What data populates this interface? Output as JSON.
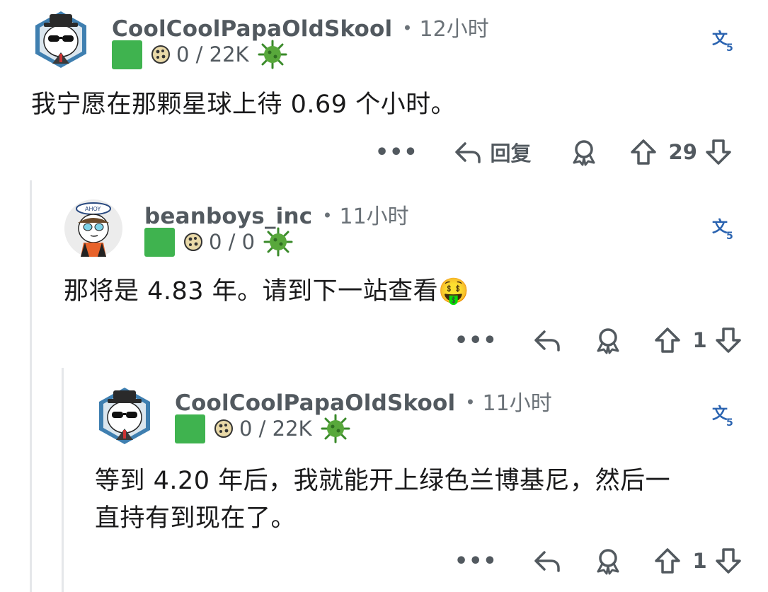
{
  "comments": [
    {
      "username": "CoolCoolPapaOldSkool",
      "separator": "•",
      "time": "12小时",
      "flair": "0 / 22K",
      "body": "我宁愿在那颗星球上待 0.69 个小时。",
      "reply_label": "回复",
      "score": "29",
      "more": "•••"
    },
    {
      "username": "beanboys_inc",
      "separator": "•",
      "time": "11小时",
      "flair": "0 / 0",
      "body": "那将是 4.83 年。请到下一站查看",
      "emoji": "🤑",
      "score": "1",
      "more": "•••"
    },
    {
      "username": "CoolCoolPapaOldSkool",
      "separator": "•",
      "time": "11小时",
      "flair": "0 / 22K",
      "body_line1": "等到 4.20 年后，我就能开上绿色兰博基尼，然后一",
      "body_line2": "直持有到现在了。",
      "score": "1",
      "more": "•••"
    }
  ],
  "icons": {
    "translate": "translate-icon",
    "reply": "reply-arrow-icon",
    "award": "award-icon",
    "upvote": "upvote-arrow-icon",
    "downvote": "downvote-arrow-icon",
    "coin": "cookie-coin-icon",
    "virus": "virus-icon"
  },
  "colors": {
    "text": "#1a1a1b",
    "meta": "#52595f",
    "flair_green": "#3fb34f",
    "virus_green": "#3a8a2a",
    "avatar_ring": "#3f7fb0",
    "thread_line": "#e5e7ea"
  }
}
